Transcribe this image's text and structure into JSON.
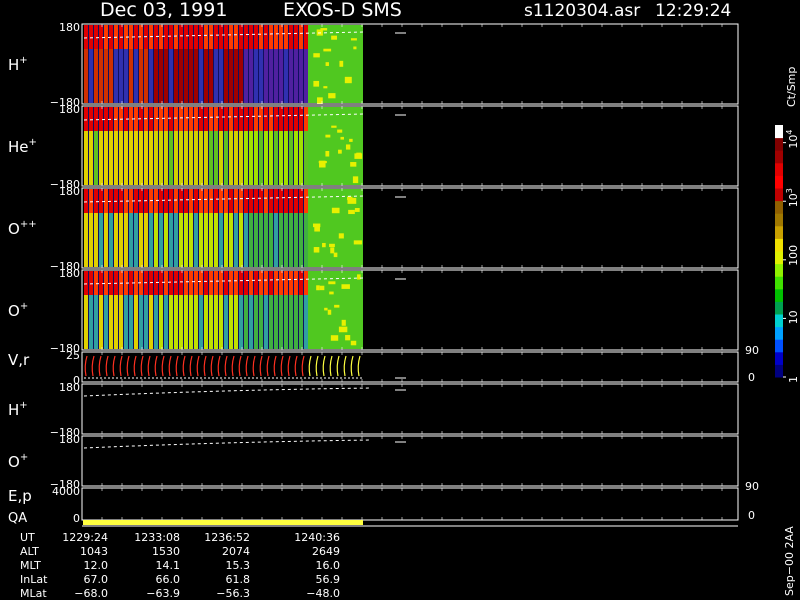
{
  "header": {
    "date": "Dec 03, 1991",
    "instrument": "EXOS-D SMS",
    "file": "s1120304.asr",
    "time": "12:29:24"
  },
  "chart_data": {
    "type": "heatmap",
    "panels": [
      {
        "id": "h-plus",
        "label": "H",
        "sup": "+",
        "ytop": "180",
        "ybot": "−180",
        "kind": "spectrogram"
      },
      {
        "id": "he-plus",
        "label": "He",
        "sup": "+",
        "ytop": "180",
        "ybot": "−180",
        "kind": "spectrogram"
      },
      {
        "id": "o-pp",
        "label": "O",
        "sup": "++",
        "ytop": "180",
        "ybot": "−180",
        "kind": "spectrogram"
      },
      {
        "id": "o-plus",
        "label": "O",
        "sup": "+",
        "ytop": "180",
        "ybot": "−180",
        "kind": "spectrogram"
      },
      {
        "id": "vr",
        "label": "V,r",
        "sup": "",
        "ytop": "25",
        "ybot": "0",
        "rtop": "90",
        "rbot": "0",
        "kind": "vr"
      },
      {
        "id": "h-plus-2",
        "label": "H",
        "sup": "+",
        "ytop": "180",
        "ybot": "−180",
        "kind": "line"
      },
      {
        "id": "o-plus-2",
        "label": "O",
        "sup": "+",
        "ytop": "180",
        "ybot": "−180",
        "kind": "line"
      },
      {
        "id": "ep",
        "label": "E,p",
        "sup": "",
        "ytop": "4000",
        "ybot": "0",
        "rtop": "90",
        "rbot": "0",
        "kind": "ep"
      }
    ],
    "qa_label": "QA",
    "colorbar": {
      "unit": "Ct/Smp",
      "ticks": [
        {
          "text": "1",
          "value": 1
        },
        {
          "text": "10",
          "value": 10
        },
        {
          "text": "100",
          "value": 100
        },
        {
          "text": "10",
          "sup": "3",
          "value": 1000
        },
        {
          "text": "10",
          "sup": "4",
          "value": 10000
        }
      ],
      "colors": [
        "#000080",
        "#0000c8",
        "#0050ff",
        "#00a0ff",
        "#00d0d0",
        "#00a050",
        "#00c000",
        "#40e000",
        "#90f000",
        "#e0f000",
        "#f0e000",
        "#c8a000",
        "#a07800",
        "#906000",
        "#c00000",
        "#ff0000",
        "#e00000",
        "#a00000",
        "#800000",
        "#ffffff"
      ]
    },
    "ephemeris": {
      "labels": [
        "UT",
        "ALT",
        "MLT",
        "InLat",
        "MLat"
      ],
      "columns": [
        [
          "1229:24",
          "1043",
          "12.0",
          "67.0",
          "−68.0"
        ],
        [
          "1233:08",
          "1530",
          "14.1",
          "66.0",
          "−63.9"
        ],
        [
          "1236:52",
          "2074",
          "15.3",
          "61.8",
          "−56.3"
        ],
        [
          "1240:36",
          "2649",
          "16.0",
          "56.9",
          "−48.0"
        ]
      ]
    },
    "footer_note": "Sep−00 2AA"
  }
}
